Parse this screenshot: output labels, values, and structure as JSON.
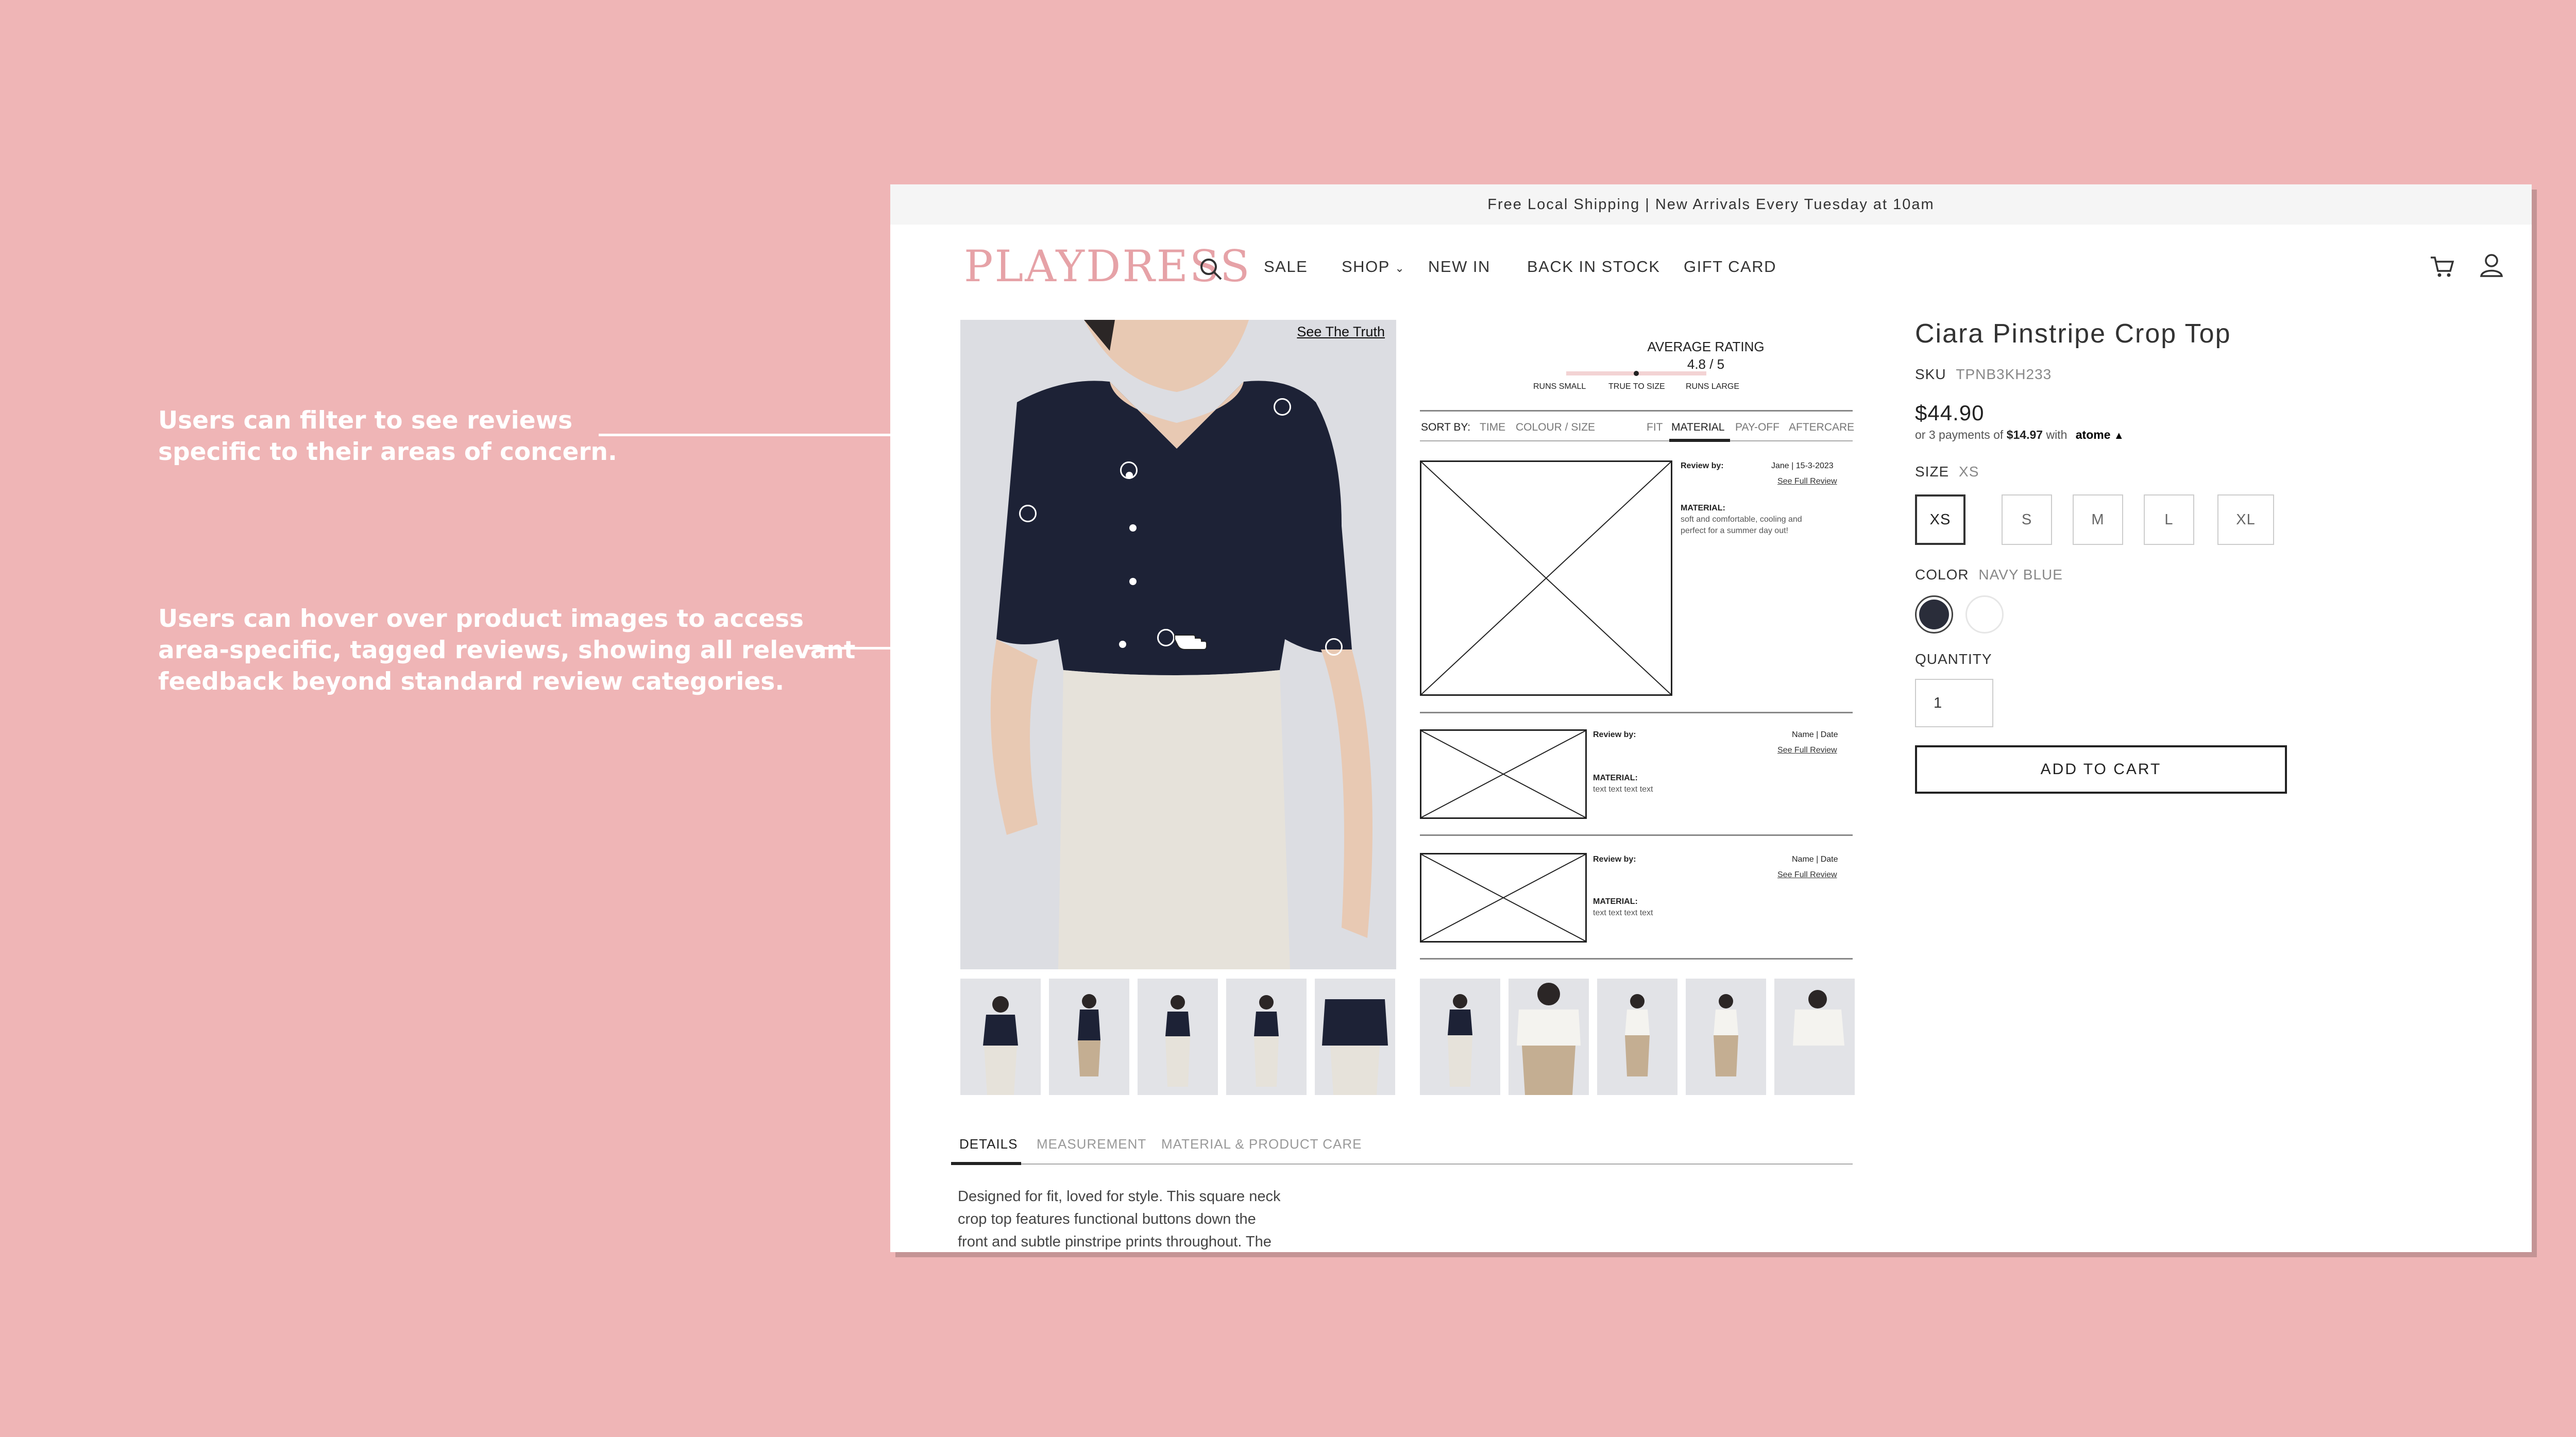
{
  "annotations": {
    "filter": [
      "Users can filter to see reviews",
      "specific to their areas of concern."
    ],
    "hover": [
      "Users can hover over product images to access",
      "area-specific, tagged reviews, showing all relevant",
      "feedback beyond standard review categories."
    ]
  },
  "promo_bar": "Free Local Shipping | New Arrivals Every Tuesday at 10am",
  "logo": "PLAYDRESS",
  "nav": {
    "sale": "SALE",
    "shop": "SHOP",
    "new_in": "NEW IN",
    "back_in_stock": "BACK IN STOCK",
    "gift_card": "GIFT CARD"
  },
  "gallery": {
    "see_truth": "See The Truth"
  },
  "rating": {
    "title": "AVERAGE RATING",
    "value": "4.8 / 5",
    "fit_labels": [
      "RUNS SMALL",
      "TRUE TO SIZE",
      "RUNS LARGE"
    ],
    "fit_position": 0.5
  },
  "sort": {
    "label": "SORT BY:",
    "options": [
      "TIME",
      "COLOUR / SIZE"
    ],
    "filters": [
      "FIT",
      "MATERIAL",
      "PAY-OFF",
      "AFTERCARE"
    ],
    "active_filter": "MATERIAL"
  },
  "reviews": [
    {
      "by": "Review by:",
      "meta": "Jane | 15-3-2023",
      "link": "See Full Review",
      "tag": "MATERIAL:",
      "text": [
        "soft and comfortable, cooling and",
        "perfect for a summer day out!"
      ]
    },
    {
      "by": "Review by:",
      "meta": "Name | Date",
      "link": "See Full Review",
      "tag": "MATERIAL:",
      "text": [
        "text text text text"
      ]
    },
    {
      "by": "Review by:",
      "meta": "Name | Date",
      "link": "See Full Review",
      "tag": "MATERIAL:",
      "text": [
        "text text text text"
      ]
    }
  ],
  "tabs": [
    "DETAILS",
    "MEASUREMENT",
    "MATERIAL & PRODUCT CARE"
  ],
  "active_tab": "DETAILS",
  "description": [
    "Designed for fit, loved for style. This square neck",
    "crop top features functional buttons down the",
    "front and subtle pinstripe prints throughout. The"
  ],
  "product": {
    "title": "Ciara Pinstripe Crop Top",
    "sku_label": "SKU",
    "sku": "TPNB3KH233",
    "price": "$44.90",
    "installment_prefix": "or 3 payments of",
    "installment_amount": "$14.97",
    "installment_with": "with",
    "installment_brand": "atome",
    "size_label": "SIZE",
    "size_selected": "XS",
    "sizes": [
      "XS",
      "S",
      "M",
      "L",
      "XL"
    ],
    "color_label": "COLOR",
    "color_selected": "NAVY BLUE",
    "colors": [
      "#2a2d3a",
      "#ffffff"
    ],
    "quantity_label": "QUANTITY",
    "quantity": "1",
    "add_to_cart": "ADD TO CART"
  },
  "colors": {
    "background": "#efb5b6",
    "logo": "#e6a2a7",
    "top_navy": "#1d2236",
    "pants": "#e6e2da"
  }
}
